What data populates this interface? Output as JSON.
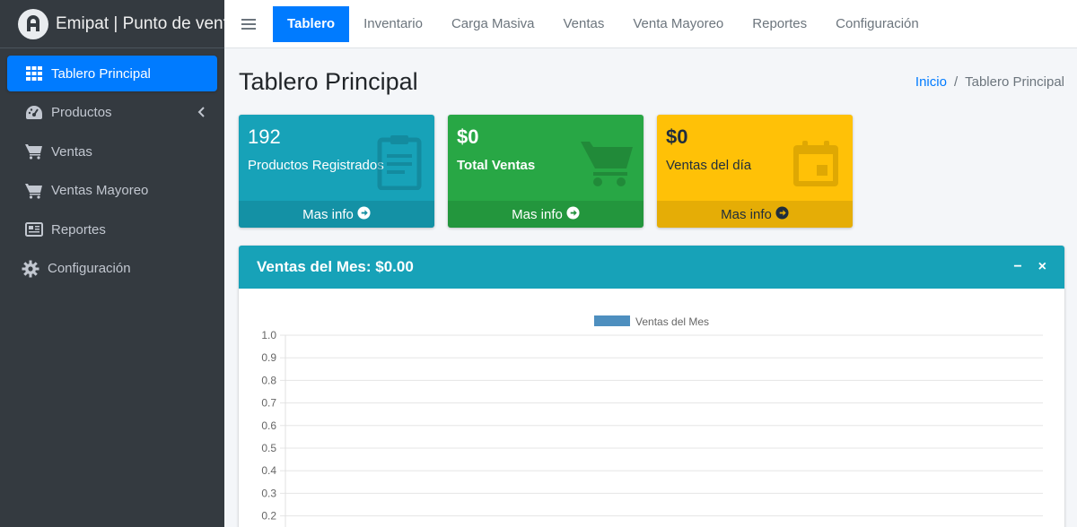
{
  "brand": {
    "name": "Emipat | Punto de venta"
  },
  "sidebar": {
    "items": [
      {
        "label": "Tablero Principal",
        "icon": "grid-icon",
        "active": true
      },
      {
        "label": "Productos",
        "icon": "tachometer-icon",
        "has_submenu": true
      },
      {
        "label": "Ventas",
        "icon": "cart-icon"
      },
      {
        "label": "Ventas Mayoreo",
        "icon": "cart-icon"
      },
      {
        "label": "Reportes",
        "icon": "newspaper-icon"
      },
      {
        "label": "Configuración",
        "icon": "gear-icon"
      }
    ]
  },
  "topnav": {
    "items": [
      {
        "label": "Tablero",
        "active": true
      },
      {
        "label": "Inventario"
      },
      {
        "label": "Carga Masiva"
      },
      {
        "label": "Ventas"
      },
      {
        "label": "Venta Mayoreo"
      },
      {
        "label": "Reportes"
      },
      {
        "label": "Configuración"
      }
    ]
  },
  "page": {
    "title": "Tablero Principal",
    "breadcrumb": {
      "home": "Inicio",
      "separator": "/",
      "current": "Tablero Principal"
    }
  },
  "boxes": [
    {
      "value": "192",
      "label": "Productos Registrados",
      "footer": "Mas info",
      "color": "#17a2b8",
      "icon": "clipboard-icon"
    },
    {
      "value": "$0",
      "label": "Total Ventas",
      "footer": "Mas info",
      "color": "#28a745",
      "icon": "cart-icon"
    },
    {
      "value": "$0",
      "label": "Ventas del día",
      "footer": "Mas info",
      "color": "#ffc107",
      "icon": "calendar-icon"
    }
  ],
  "card": {
    "title": "Ventas del Mes: $0.00",
    "collapse_symbol": "−",
    "close_symbol": "×"
  },
  "chart_data": {
    "type": "bar",
    "series": [
      {
        "name": "Ventas del Mes",
        "values": []
      }
    ],
    "ylim": [
      0,
      1.0
    ],
    "yticks": [
      "1.0",
      "0.9",
      "0.8",
      "0.7",
      "0.6",
      "0.5",
      "0.4",
      "0.3",
      "0.2"
    ],
    "legend_color": "#4e8fbf",
    "legend_position": "top-center",
    "grid": true
  }
}
